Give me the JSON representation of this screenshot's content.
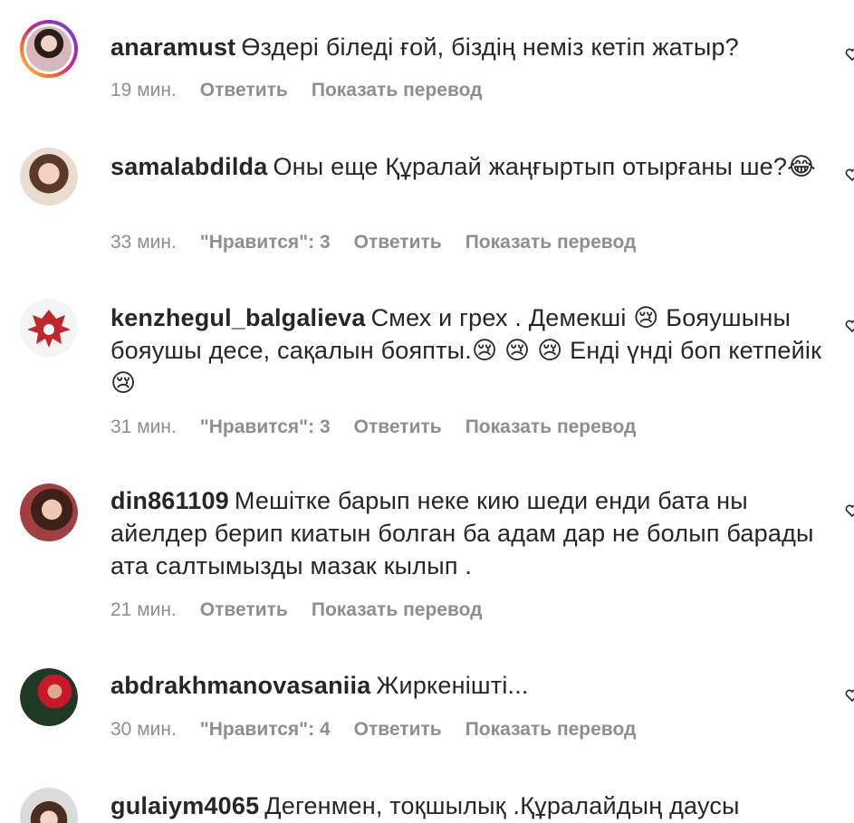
{
  "labels": {
    "reply": "Ответить",
    "translate": "Показать перевод"
  },
  "comments": [
    {
      "username": "anaramust",
      "text": "Өздері біледі ғой, біздің неміз кетіп жатыр?",
      "time": "19 мин.",
      "likes": ""
    },
    {
      "username": "samalabdilda",
      "text": "Оны еще Құралай жаңғыртып отырғаны ше?😂",
      "time": "33 мин.",
      "likes": "\"Нравится\": 3"
    },
    {
      "username": "kenzhegul_balgalieva",
      "text": "Смех и грех . Демекші 😢 Бояушыны бояушы десе, сақалын бояпты.😢 😢 😢  Енді үнді боп кетпейік😢",
      "time": "31 мин.",
      "likes": "\"Нравится\": 3"
    },
    {
      "username": "din861109",
      "text": "Мешітке барып неке кию шеди енди бата ны айелдер берип киатын болган ба адам дар не болып барады ата салтымызды мазак кылып .",
      "time": "21 мин.",
      "likes": ""
    },
    {
      "username": "abdrakhmanovasaniia",
      "text": "Жиркенішті...",
      "time": "30 мин.",
      "likes": "\"Нравится\": 4"
    },
    {
      "username": "gulaiym4065",
      "text": "Дегенмен, тоқшылық .Құралайдың даусы",
      "time": "",
      "likes": ""
    }
  ],
  "colors": {
    "text": "#262626",
    "meta": "#8e8e8e",
    "story_ring": "#d62976"
  }
}
